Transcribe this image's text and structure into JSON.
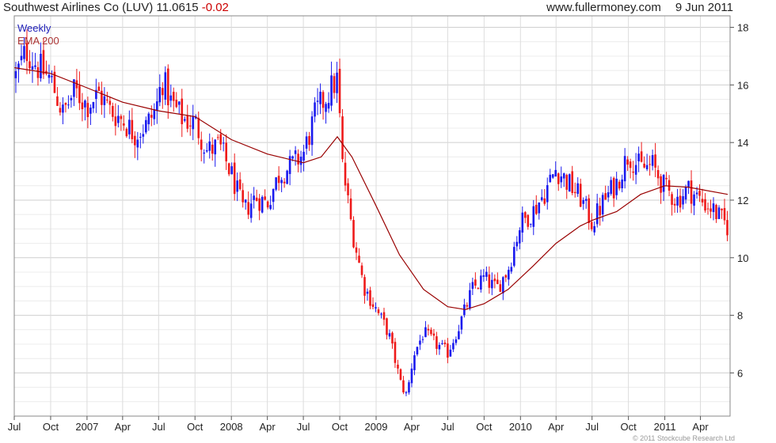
{
  "header": {
    "company": "Southwest Airlines Co (LUV)",
    "price": "11.0615",
    "change": "-0.02",
    "website": "www.fullermoney.com",
    "date": "9 Jun 2011"
  },
  "footer": {
    "copyright": "© 2011 Stockcube Research Ltd"
  },
  "colors": {
    "up": "#1a1aee",
    "down": "#ee1a1a",
    "ema": "#990000",
    "grid": "#dcdcdc",
    "frame": "#888888"
  },
  "chart_data": {
    "type": "ohlc-line",
    "legend": [
      "Weekly",
      "EMA 200"
    ],
    "legend_placement": "top-left",
    "grid": true,
    "ylim": [
      4.5,
      18.4
    ],
    "y_ticks": [
      6,
      8,
      10,
      12,
      14,
      16,
      18
    ],
    "y_tick_labels": [
      "6",
      "8",
      "10",
      "12",
      "14",
      "16",
      "18"
    ],
    "x_range": [
      "2006-07-01",
      "2011-06-15"
    ],
    "x_ticks": [
      {
        "date": "2006-07-01",
        "label": "Jul"
      },
      {
        "date": "2006-10-01",
        "label": "Oct"
      },
      {
        "date": "2007-01-01",
        "label": "2007"
      },
      {
        "date": "2007-04-01",
        "label": "Apr"
      },
      {
        "date": "2007-07-01",
        "label": "Jul"
      },
      {
        "date": "2007-10-01",
        "label": "Oct"
      },
      {
        "date": "2008-01-01",
        "label": "2008"
      },
      {
        "date": "2008-04-01",
        "label": "Apr"
      },
      {
        "date": "2008-07-01",
        "label": "Jul"
      },
      {
        "date": "2008-10-01",
        "label": "Oct"
      },
      {
        "date": "2009-01-01",
        "label": "2009"
      },
      {
        "date": "2009-04-01",
        "label": "Apr"
      },
      {
        "date": "2009-07-01",
        "label": "Jul"
      },
      {
        "date": "2009-10-01",
        "label": "Oct"
      },
      {
        "date": "2010-01-01",
        "label": "2010"
      },
      {
        "date": "2010-04-01",
        "label": "Apr"
      },
      {
        "date": "2010-07-01",
        "label": "Jul"
      },
      {
        "date": "2010-10-01",
        "label": "Oct"
      },
      {
        "date": "2011-01-01",
        "label": "2011"
      },
      {
        "date": "2011-04-01",
        "label": "Apr"
      }
    ],
    "series": [
      {
        "name": "Weekly",
        "close_anchors": [
          [
            "2006-07-05",
            16.3
          ],
          [
            "2006-08-01",
            17.2
          ],
          [
            "2006-09-01",
            16.6
          ],
          [
            "2006-10-01",
            16.2
          ],
          [
            "2006-11-01",
            15.0
          ],
          [
            "2006-12-01",
            15.8
          ],
          [
            "2007-01-01",
            15.3
          ],
          [
            "2007-02-01",
            15.7
          ],
          [
            "2007-03-01",
            15.1
          ],
          [
            "2007-04-01",
            14.8
          ],
          [
            "2007-05-01",
            14.3
          ],
          [
            "2007-06-01",
            14.6
          ],
          [
            "2007-06-25",
            15.2
          ],
          [
            "2007-07-10",
            16.2
          ],
          [
            "2007-08-01",
            15.4
          ],
          [
            "2007-09-01",
            14.8
          ],
          [
            "2007-10-01",
            14.7
          ],
          [
            "2007-11-01",
            13.7
          ],
          [
            "2007-12-01",
            13.9
          ],
          [
            "2008-01-01",
            12.9
          ],
          [
            "2008-02-01",
            11.6
          ],
          [
            "2008-03-01",
            12.1
          ],
          [
            "2008-04-01",
            11.9
          ],
          [
            "2008-05-01",
            12.9
          ],
          [
            "2008-06-01",
            13.2
          ],
          [
            "2008-07-01",
            13.6
          ],
          [
            "2008-08-01",
            15.0
          ],
          [
            "2008-09-01",
            15.7
          ],
          [
            "2008-09-25",
            16.2
          ],
          [
            "2008-10-08",
            13.2
          ],
          [
            "2008-11-01",
            11.0
          ],
          [
            "2008-12-01",
            9.0
          ],
          [
            "2009-01-01",
            8.2
          ],
          [
            "2009-02-01",
            7.4
          ],
          [
            "2009-03-05",
            5.6
          ],
          [
            "2009-03-20",
            5.2
          ],
          [
            "2009-04-05",
            6.6
          ],
          [
            "2009-05-01",
            7.4
          ],
          [
            "2009-06-01",
            7.0
          ],
          [
            "2009-07-01",
            6.7
          ],
          [
            "2009-08-01",
            7.7
          ],
          [
            "2009-09-01",
            8.9
          ],
          [
            "2009-10-01",
            9.3
          ],
          [
            "2009-11-01",
            8.9
          ],
          [
            "2009-12-01",
            9.6
          ],
          [
            "2010-01-01",
            11.2
          ],
          [
            "2010-02-01",
            11.6
          ],
          [
            "2010-03-01",
            12.2
          ],
          [
            "2010-04-01",
            13.1
          ],
          [
            "2010-05-01",
            12.6
          ],
          [
            "2010-06-01",
            12.1
          ],
          [
            "2010-07-01",
            11.2
          ],
          [
            "2010-08-01",
            12.0
          ],
          [
            "2010-09-01",
            12.6
          ],
          [
            "2010-10-01",
            13.6
          ],
          [
            "2010-11-01",
            13.1
          ],
          [
            "2010-12-01",
            13.2
          ],
          [
            "2011-01-01",
            12.4
          ],
          [
            "2011-02-01",
            12.0
          ],
          [
            "2011-03-01",
            12.4
          ],
          [
            "2011-04-01",
            12.0
          ],
          [
            "2011-05-01",
            11.7
          ],
          [
            "2011-06-09",
            11.06
          ]
        ]
      },
      {
        "name": "EMA 200",
        "points": [
          [
            "2006-07-01",
            16.6
          ],
          [
            "2006-10-01",
            16.4
          ],
          [
            "2007-01-01",
            15.9
          ],
          [
            "2007-04-01",
            15.4
          ],
          [
            "2007-07-01",
            15.1
          ],
          [
            "2007-10-01",
            14.9
          ],
          [
            "2008-01-01",
            14.1
          ],
          [
            "2008-04-01",
            13.6
          ],
          [
            "2008-07-01",
            13.3
          ],
          [
            "2008-08-15",
            13.5
          ],
          [
            "2008-09-25",
            14.2
          ],
          [
            "2008-11-01",
            13.5
          ],
          [
            "2009-01-01",
            11.8
          ],
          [
            "2009-03-01",
            10.1
          ],
          [
            "2009-05-01",
            8.9
          ],
          [
            "2009-07-01",
            8.3
          ],
          [
            "2009-08-15",
            8.2
          ],
          [
            "2009-10-01",
            8.4
          ],
          [
            "2009-12-01",
            8.9
          ],
          [
            "2010-02-01",
            9.7
          ],
          [
            "2010-04-01",
            10.5
          ],
          [
            "2010-06-01",
            11.1
          ],
          [
            "2010-07-01",
            11.3
          ],
          [
            "2010-09-01",
            11.6
          ],
          [
            "2010-11-01",
            12.2
          ],
          [
            "2011-01-01",
            12.5
          ],
          [
            "2011-03-01",
            12.45
          ],
          [
            "2011-06-09",
            12.2
          ]
        ]
      }
    ]
  }
}
